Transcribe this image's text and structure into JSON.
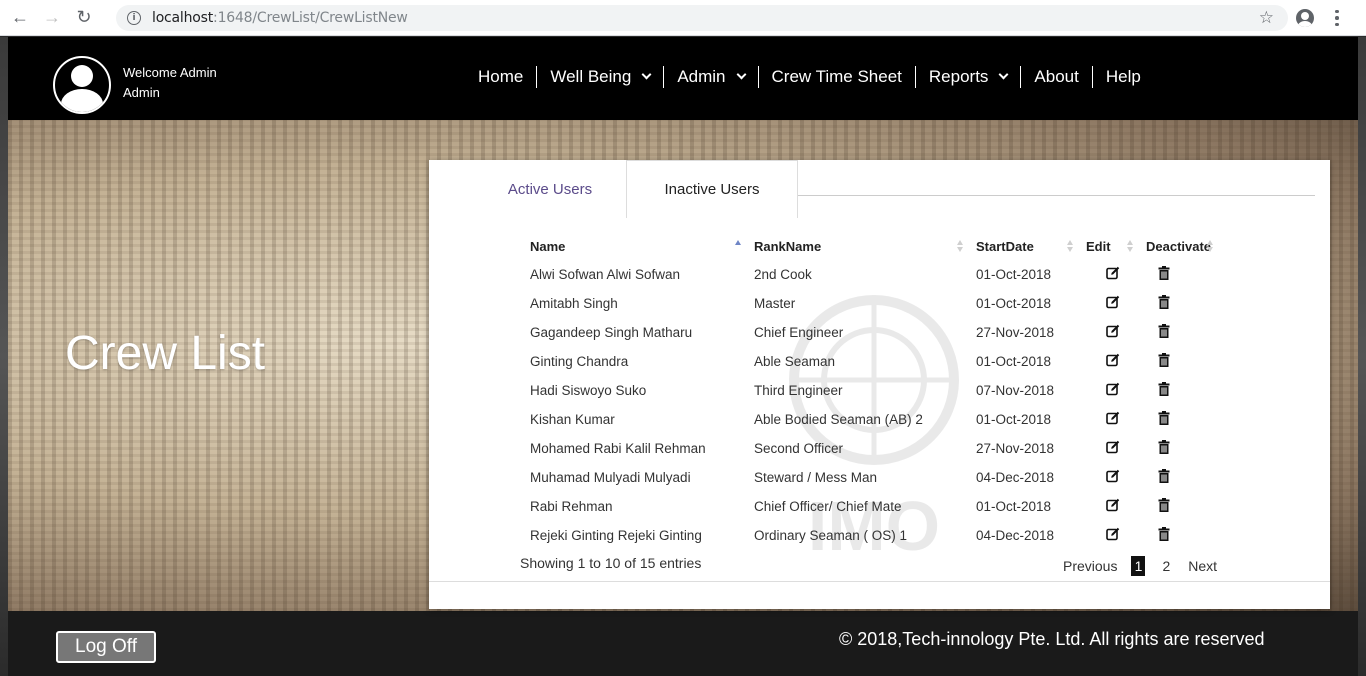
{
  "browser": {
    "url_host": "localhost",
    "url_path": ":1648/CrewList/CrewListNew"
  },
  "header": {
    "welcome_line1": "Welcome Admin",
    "welcome_line2": "Admin",
    "menu": [
      {
        "label": "Home",
        "dropdown": false
      },
      {
        "label": "Well Being",
        "dropdown": true
      },
      {
        "label": "Admin",
        "dropdown": true
      },
      {
        "label": "Crew Time Sheet",
        "dropdown": false
      },
      {
        "label": "Reports",
        "dropdown": true
      },
      {
        "label": "About",
        "dropdown": false
      },
      {
        "label": "Help",
        "dropdown": false
      }
    ]
  },
  "hero": {
    "title": "Crew List"
  },
  "tabs": {
    "active": "Active Users",
    "inactive": "Inactive Users"
  },
  "table": {
    "columns": [
      "Name",
      "RankName",
      "StartDate",
      "Edit",
      "Deactivate"
    ],
    "rows": [
      {
        "name": "Alwi Sofwan Alwi Sofwan",
        "rank": "2nd Cook",
        "date": "01-Oct-2018"
      },
      {
        "name": "Amitabh Singh",
        "rank": "Master",
        "date": "01-Oct-2018"
      },
      {
        "name": "Gagandeep Singh Matharu",
        "rank": "Chief Engineer",
        "date": "27-Nov-2018"
      },
      {
        "name": "Ginting Chandra",
        "rank": "Able Seaman",
        "date": "01-Oct-2018"
      },
      {
        "name": "Hadi Siswoyo Suko",
        "rank": "Third Engineer",
        "date": "07-Nov-2018"
      },
      {
        "name": "Kishan Kumar",
        "rank": "Able Bodied Seaman (AB) 2",
        "date": "01-Oct-2018"
      },
      {
        "name": "Mohamed Rabi Kalil Rehman",
        "rank": "Second Officer",
        "date": "27-Nov-2018"
      },
      {
        "name": "Muhamad Mulyadi Mulyadi",
        "rank": "Steward / Mess Man",
        "date": "04-Dec-2018"
      },
      {
        "name": "Rabi Rehman",
        "rank": "Chief Officer/ Chief Mate",
        "date": "01-Oct-2018"
      },
      {
        "name": "Rejeki Ginting Rejeki Ginting",
        "rank": "Ordinary Seaman ( OS) 1",
        "date": "04-Dec-2018"
      }
    ],
    "info": "Showing 1 to 10 of 15 entries"
  },
  "pagination": {
    "previous": "Previous",
    "current": "1",
    "page2": "2",
    "next": "Next"
  },
  "footer": {
    "logoff": "Log Off",
    "copyright": "© 2018,Tech-innology Pte. Ltd. All rights are reserved"
  },
  "icons": {
    "edit": "edit-icon",
    "delete": "trash-icon"
  },
  "colors": {
    "active_tab": "#5b4b8a",
    "header_bg": "#000000",
    "sort_active": "#6f86c6"
  }
}
